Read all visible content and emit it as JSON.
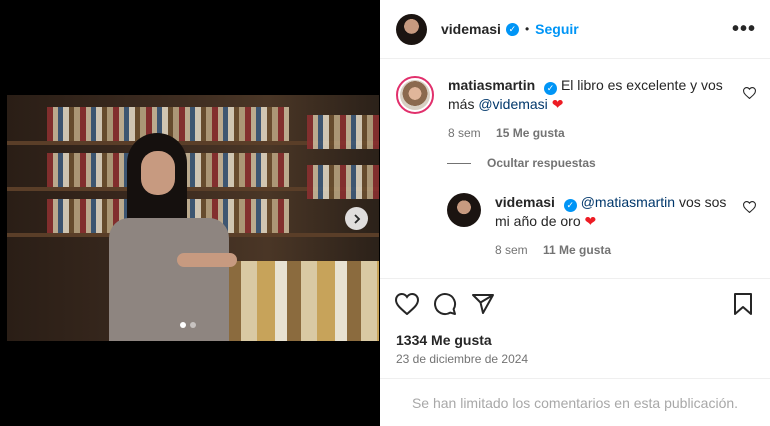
{
  "post": {
    "author": "videmasi",
    "follow_label": "Seguir",
    "separator": "•",
    "more_label": "•••",
    "carousel": {
      "current": 1,
      "total": 2
    }
  },
  "comments": [
    {
      "user": "matiasmartin",
      "text": "El libro es excelente y vos más",
      "mention": "@videmasi",
      "emoji": "❤",
      "age": "8 sem",
      "likes": "15 Me gusta"
    }
  ],
  "replies_toggle": "Ocultar respuestas",
  "replies": [
    {
      "user": "videmasi",
      "mention": "@matiasmartin",
      "text": "vos sos mi año de oro",
      "emoji": "❤",
      "age": "8 sem",
      "likes": "11 Me gusta"
    }
  ],
  "stats": {
    "likes": "1334 Me gusta",
    "date": "23 de diciembre de 2024"
  },
  "footer": {
    "limited_notice": "Se han limitado los comentarios en esta publicación."
  },
  "icons": [
    "verified-icon",
    "heart-icon",
    "comment-icon",
    "share-icon",
    "bookmark-icon",
    "chevron-right-icon"
  ]
}
